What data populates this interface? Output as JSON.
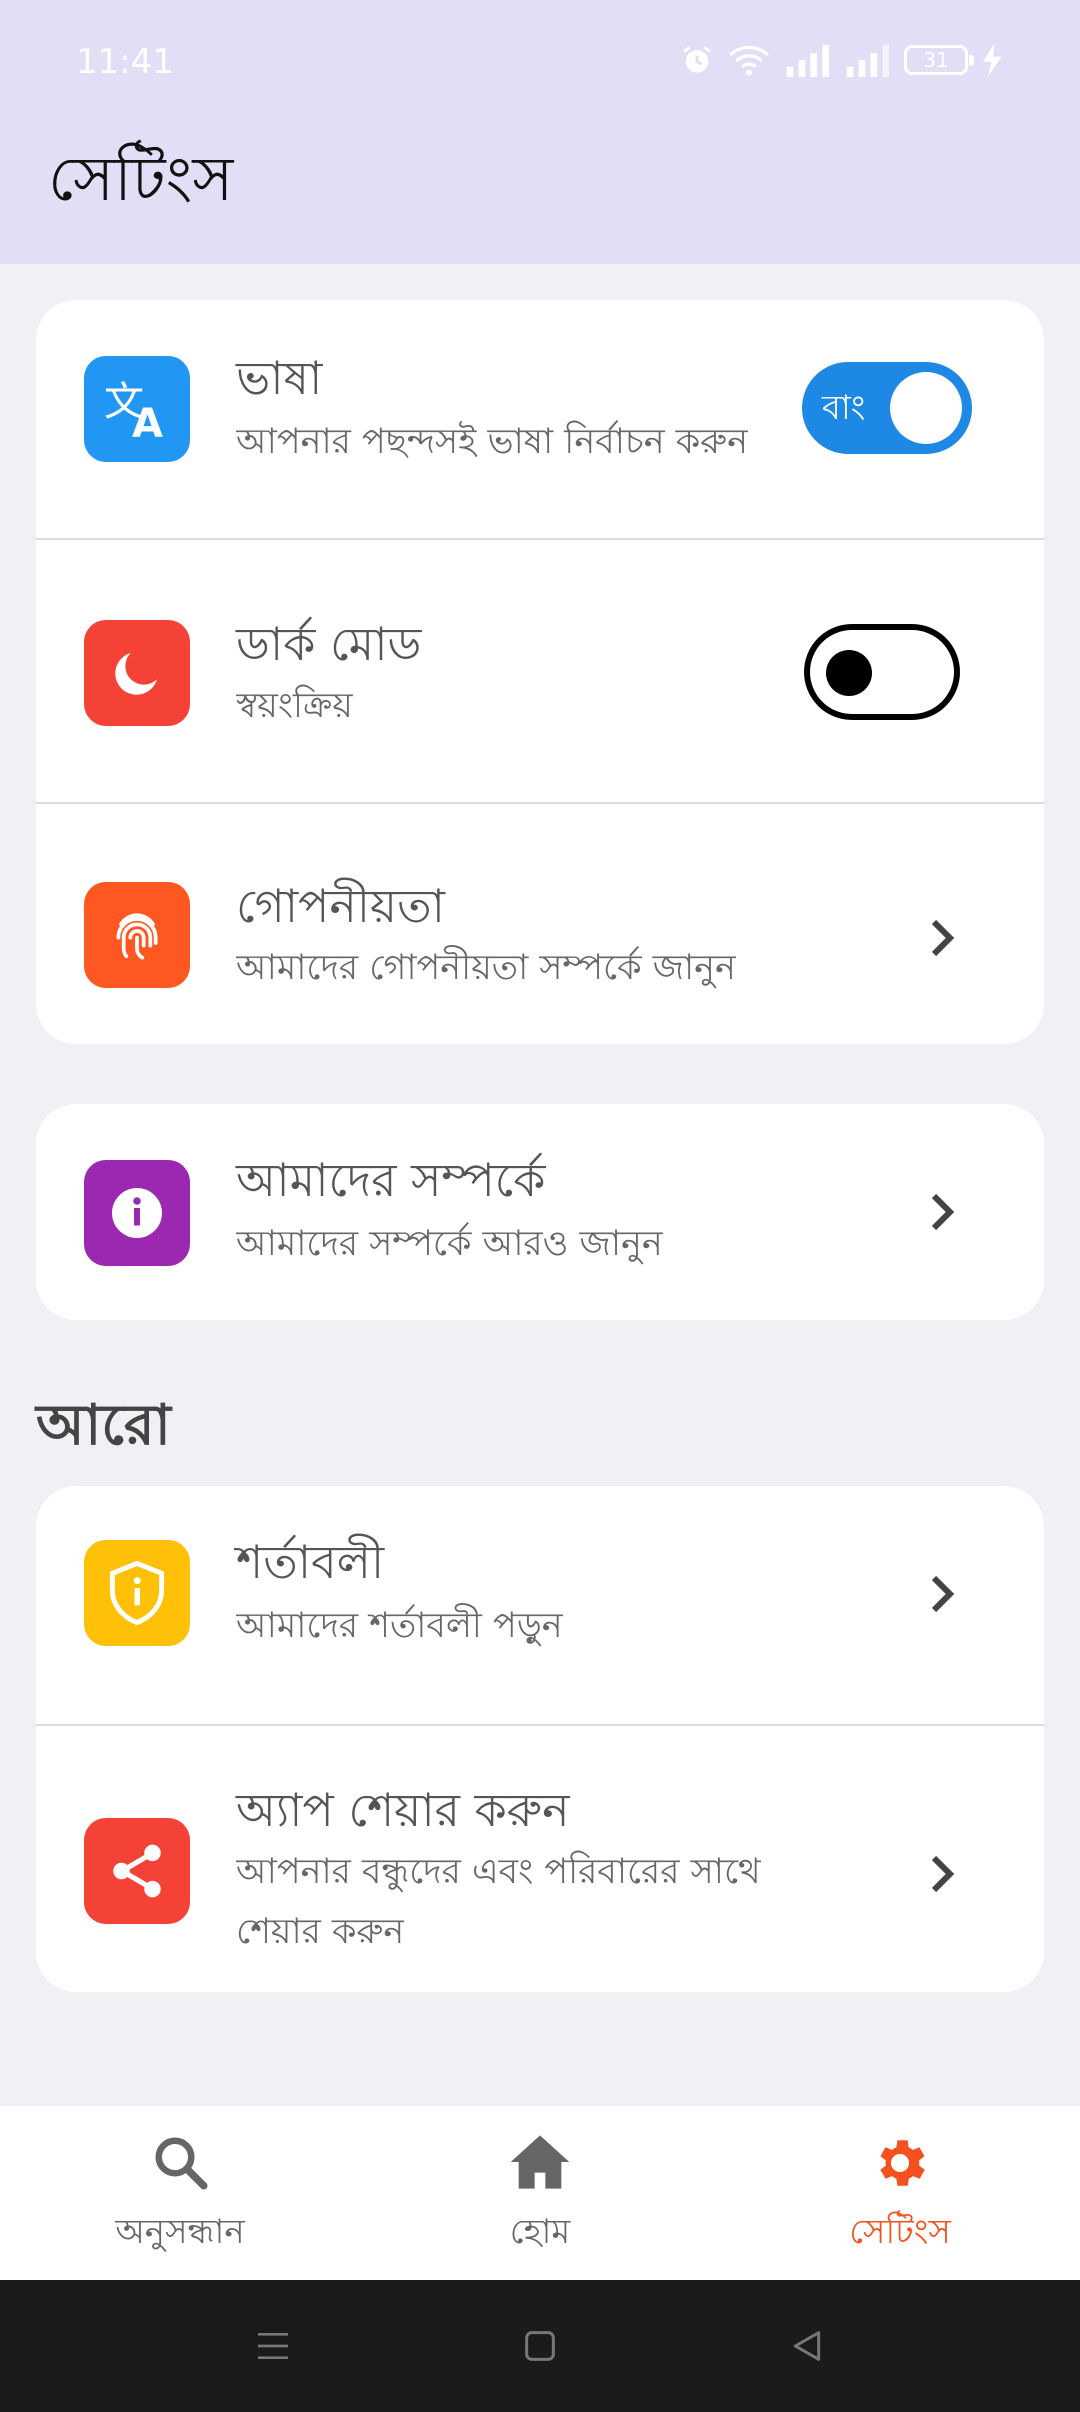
{
  "status": {
    "time": "11:41",
    "battery": "31"
  },
  "header": {
    "title": "সেটিংস"
  },
  "card1": {
    "language": {
      "title": "ভাষা",
      "subtitle": "আপনার পছন্দসই ভাষা নির্বাচন করুন",
      "toggle_label": "বাং",
      "toggle_on": true,
      "icon": "translate-icon",
      "color": "#2196f3"
    },
    "dark_mode": {
      "title": "ডার্ক মোড",
      "subtitle": "স্বয়ংক্রিয়",
      "toggle_on": false,
      "icon": "moon-icon",
      "color": "#f44336"
    },
    "privacy": {
      "title": "গোপনীয়তা",
      "subtitle": "আমাদের গোপনীয়তা সম্পর্কে জানুন",
      "icon": "fingerprint-icon",
      "color": "#ff5722"
    }
  },
  "card2": {
    "about": {
      "title": "আমাদের সম্পর্কে",
      "subtitle": "আমাদের সম্পর্কে আরও জানুন",
      "icon": "info-icon",
      "color": "#9c27b0"
    }
  },
  "more": {
    "heading": "আরো"
  },
  "card3": {
    "terms": {
      "title": "শর্তাবলী",
      "subtitle": "আমাদের শর্তাবলী পড়ুন",
      "icon": "shield-icon",
      "color": "#ffc107"
    },
    "share": {
      "title": "অ্যাপ শেয়ার  করুন",
      "subtitle_line1": "আপনার বন্ধুদের এবং পরিবারের সাথে",
      "subtitle_line2": "শেয়ার  করুন",
      "icon": "share-icon",
      "color": "#f44336"
    }
  },
  "bottom_nav": {
    "search": "অনুসন্ধান",
    "home": "হোম",
    "settings": "সেটিংস",
    "active": "settings",
    "active_color": "#f4511e"
  }
}
